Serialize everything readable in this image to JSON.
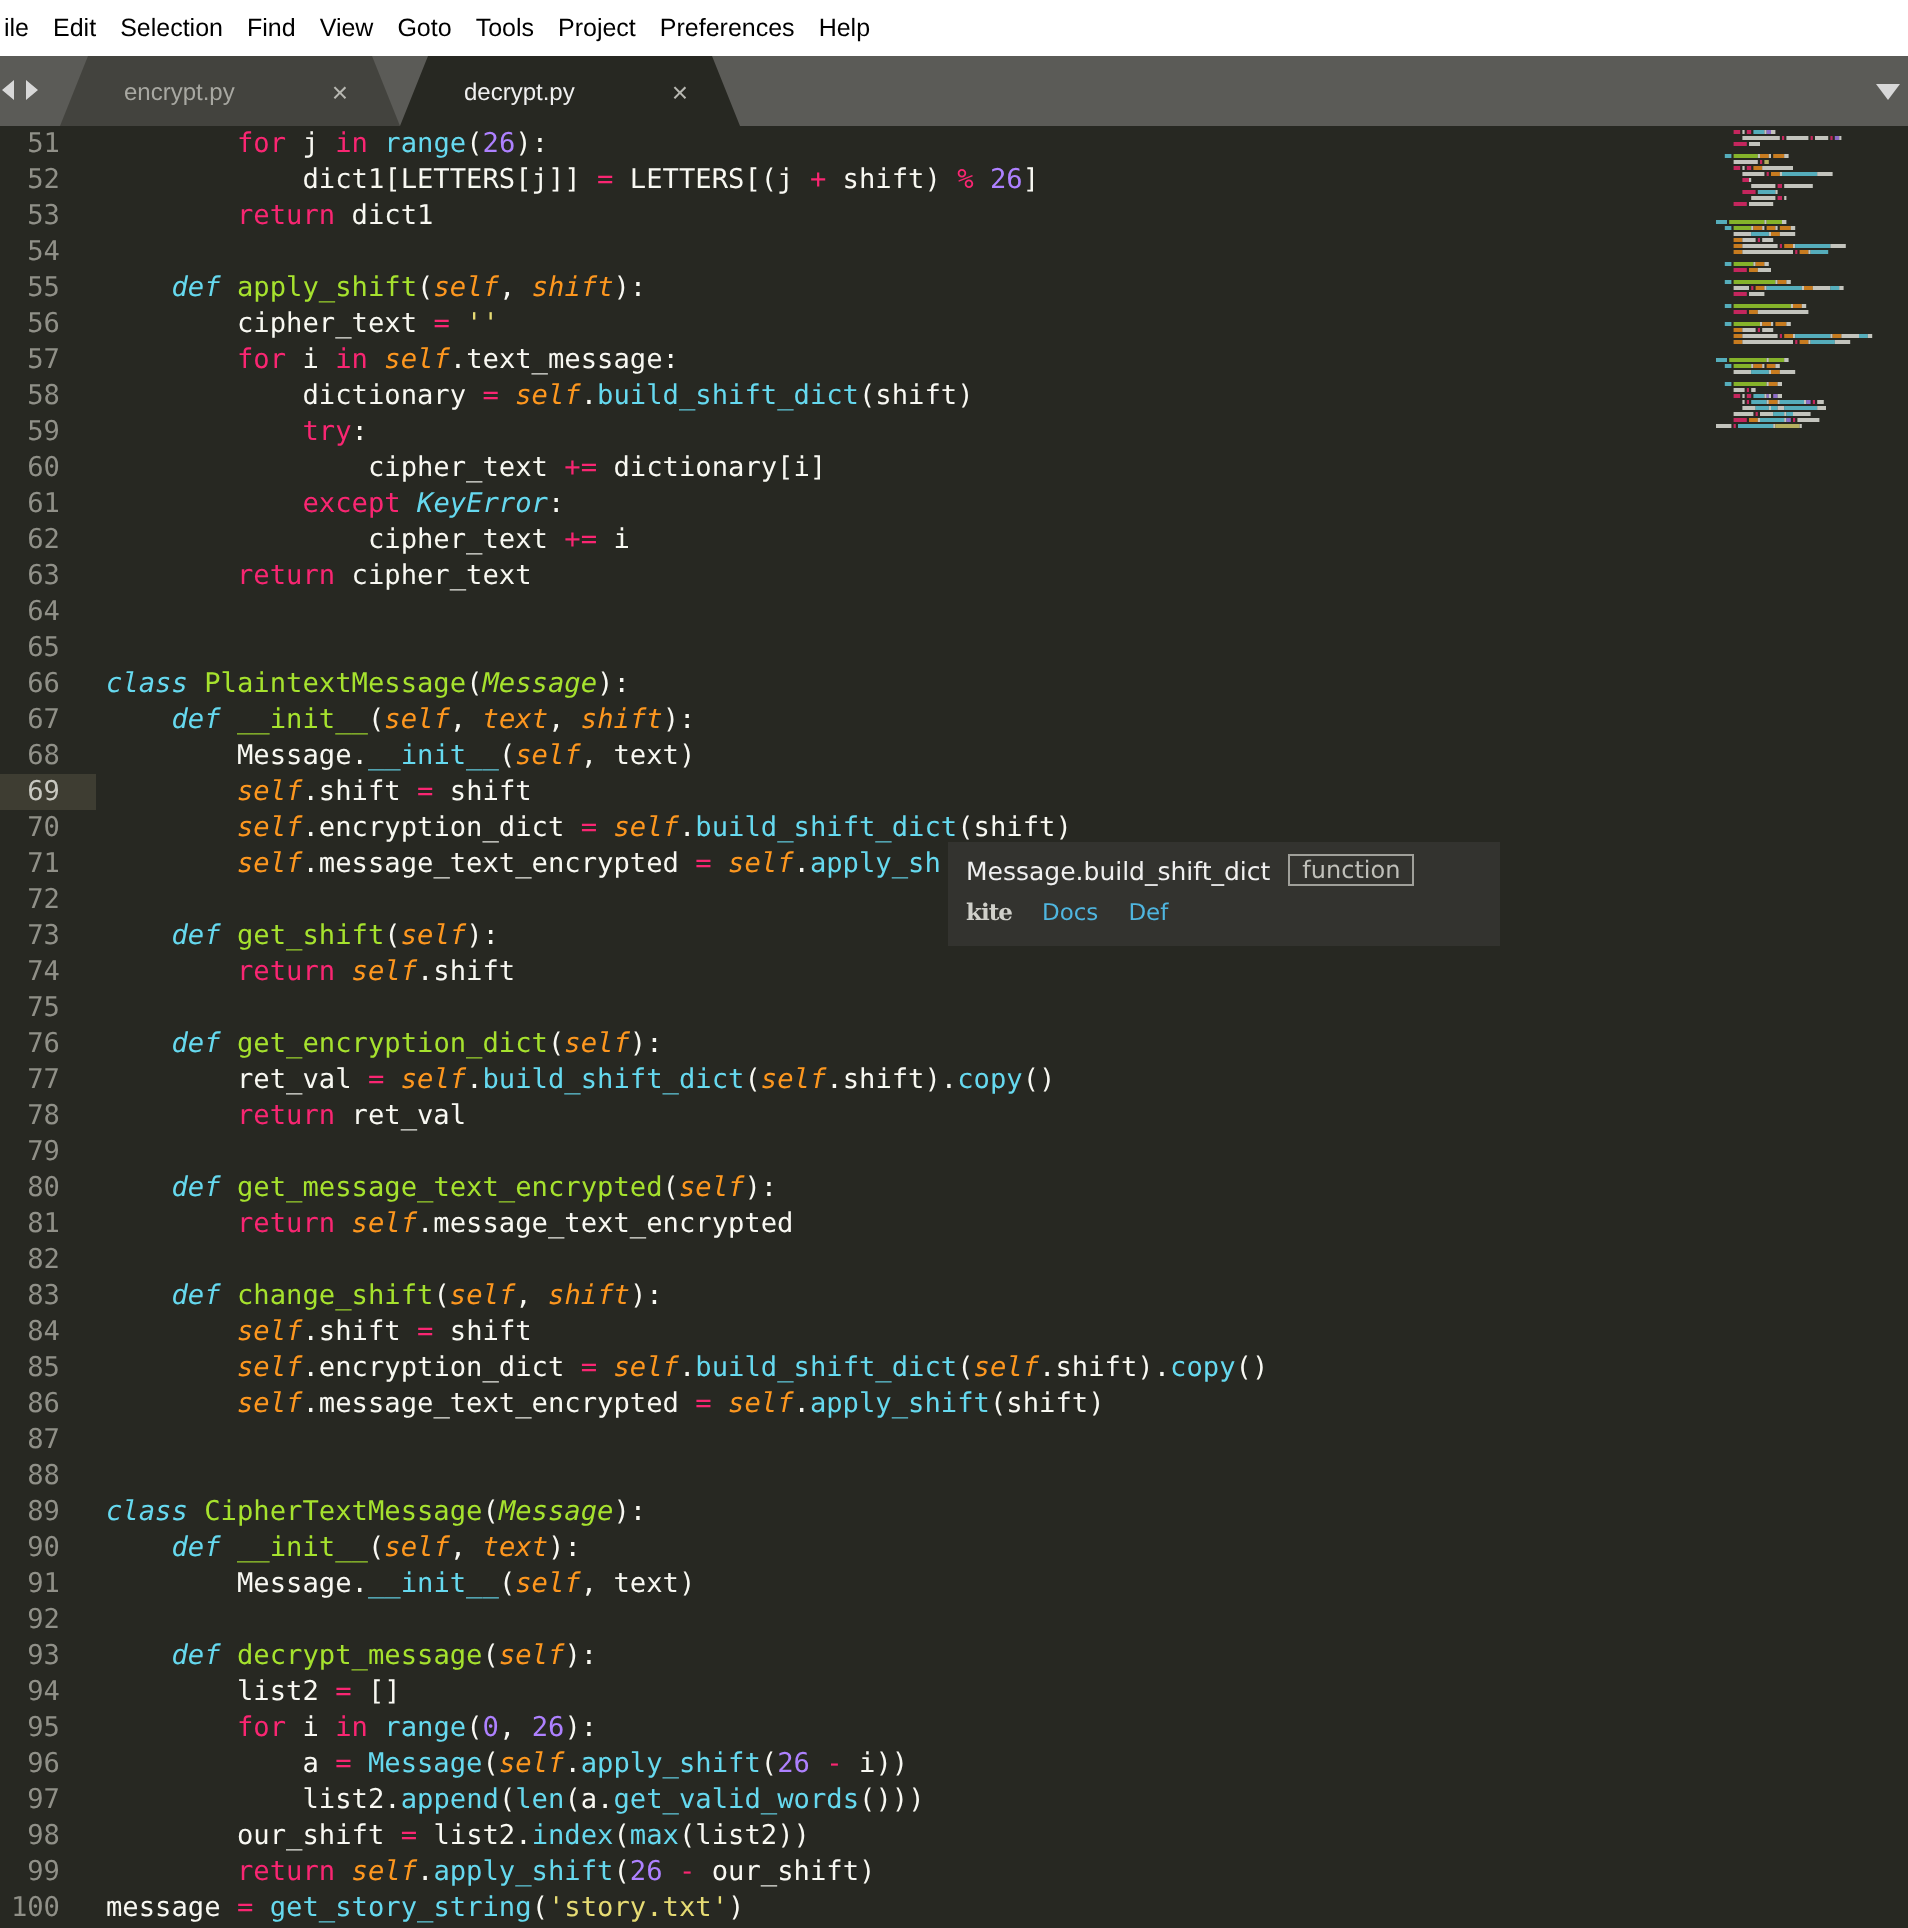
{
  "menu": [
    "ile",
    "Edit",
    "Selection",
    "Find",
    "View",
    "Goto",
    "Tools",
    "Project",
    "Preferences",
    "Help"
  ],
  "tabs": [
    {
      "label": "encrypt.py",
      "selected": false,
      "close": "×"
    },
    {
      "label": "decrypt.py",
      "selected": true,
      "close": "×"
    }
  ],
  "lines": [
    {
      "number": "51",
      "current": false,
      "tokens": [
        {
          "kind": "keyword",
          "text": "        for"
        },
        {
          "kind": "plain",
          "text": " j "
        },
        {
          "kind": "keyword",
          "text": "in"
        },
        {
          "kind": "call",
          "text": " range"
        },
        {
          "kind": "plain",
          "text": "("
        },
        {
          "kind": "number",
          "text": "26"
        },
        {
          "kind": "plain",
          "text": "):"
        }
      ]
    },
    {
      "number": "52",
      "current": false,
      "tokens": [
        {
          "kind": "plain",
          "text": "            dict1[LETTERS[j]] "
        },
        {
          "kind": "keyword",
          "text": "="
        },
        {
          "kind": "plain",
          "text": " LETTERS[(j "
        },
        {
          "kind": "keyword",
          "text": "+"
        },
        {
          "kind": "plain",
          "text": " shift) "
        },
        {
          "kind": "keyword",
          "text": "%"
        },
        {
          "kind": "number",
          "text": " 26"
        },
        {
          "kind": "plain",
          "text": "]"
        }
      ]
    },
    {
      "number": "53",
      "current": false,
      "tokens": [
        {
          "kind": "keyword",
          "text": "        return"
        },
        {
          "kind": "plain",
          "text": " dict1"
        }
      ]
    },
    {
      "number": "54",
      "current": false
    },
    {
      "number": "55",
      "current": false,
      "tokens": [
        {
          "kind": "storage",
          "text": "    def"
        },
        {
          "kind": "function",
          "text": " apply_shift"
        },
        {
          "kind": "plain",
          "text": "("
        },
        {
          "kind": "param",
          "text": "self"
        },
        {
          "kind": "plain",
          "text": ", "
        },
        {
          "kind": "param",
          "text": "shift"
        },
        {
          "kind": "plain",
          "text": "):"
        }
      ]
    },
    {
      "number": "56",
      "current": false,
      "tokens": [
        {
          "kind": "plain",
          "text": "        cipher_text "
        },
        {
          "kind": "keyword",
          "text": "="
        },
        {
          "kind": "string",
          "text": " ''"
        }
      ]
    },
    {
      "number": "57",
      "current": false,
      "tokens": [
        {
          "kind": "keyword",
          "text": "        for"
        },
        {
          "kind": "plain",
          "text": " i "
        },
        {
          "kind": "keyword",
          "text": "in"
        },
        {
          "kind": "param",
          "text": " self"
        },
        {
          "kind": "plain",
          "text": ".text_message:"
        }
      ]
    },
    {
      "number": "58",
      "current": false,
      "tokens": [
        {
          "kind": "plain",
          "text": "            dictionary "
        },
        {
          "kind": "keyword",
          "text": "="
        },
        {
          "kind": "param",
          "text": " self"
        },
        {
          "kind": "plain",
          "text": "."
        },
        {
          "kind": "call",
          "text": "build_shift_dict"
        },
        {
          "kind": "plain",
          "text": "(shift)"
        }
      ]
    },
    {
      "number": "59",
      "current": false,
      "tokens": [
        {
          "kind": "keyword",
          "text": "            try"
        },
        {
          "kind": "plain",
          "text": ":"
        }
      ]
    },
    {
      "number": "60",
      "current": false,
      "tokens": [
        {
          "kind": "plain",
          "text": "                cipher_text "
        },
        {
          "kind": "keyword",
          "text": "+="
        },
        {
          "kind": "plain",
          "text": " dictionary[i]"
        }
      ]
    },
    {
      "number": "61",
      "current": false,
      "tokens": [
        {
          "kind": "keyword",
          "text": "            except"
        },
        {
          "kind": "type",
          "text": " KeyError"
        },
        {
          "kind": "plain",
          "text": ":"
        }
      ]
    },
    {
      "number": "62",
      "current": false,
      "tokens": [
        {
          "kind": "plain",
          "text": "                cipher_text "
        },
        {
          "kind": "keyword",
          "text": "+="
        },
        {
          "kind": "plain",
          "text": " i"
        }
      ]
    },
    {
      "number": "63",
      "current": false,
      "tokens": [
        {
          "kind": "keyword",
          "text": "        return"
        },
        {
          "kind": "plain",
          "text": " cipher_text"
        }
      ]
    },
    {
      "number": "64",
      "current": false
    },
    {
      "number": "65",
      "current": false
    },
    {
      "number": "66",
      "current": false,
      "tokens": [
        {
          "kind": "storage",
          "text": "class"
        },
        {
          "kind": "function",
          "text": " PlaintextMessage"
        },
        {
          "kind": "plain",
          "text": "("
        },
        {
          "kind": "base",
          "text": "Message"
        },
        {
          "kind": "plain",
          "text": "):"
        }
      ]
    },
    {
      "number": "67",
      "current": false,
      "tokens": [
        {
          "kind": "storage",
          "text": "    def"
        },
        {
          "kind": "function",
          "text": " __init__"
        },
        {
          "kind": "plain",
          "text": "("
        },
        {
          "kind": "param",
          "text": "self"
        },
        {
          "kind": "plain",
          "text": ", "
        },
        {
          "kind": "param",
          "text": "text"
        },
        {
          "kind": "plain",
          "text": ", "
        },
        {
          "kind": "param",
          "text": "shift"
        },
        {
          "kind": "plain",
          "text": "):"
        }
      ]
    },
    {
      "number": "68",
      "current": false,
      "tokens": [
        {
          "kind": "plain",
          "text": "        Message."
        },
        {
          "kind": "call",
          "text": "__init__"
        },
        {
          "kind": "plain",
          "text": "("
        },
        {
          "kind": "param",
          "text": "self"
        },
        {
          "kind": "plain",
          "text": ", text)"
        }
      ]
    },
    {
      "number": "69",
      "current": true,
      "tokens": [
        {
          "kind": "param",
          "text": "        self"
        },
        {
          "kind": "plain",
          "text": ".shift "
        },
        {
          "kind": "keyword",
          "text": "="
        },
        {
          "kind": "plain",
          "text": " shift"
        }
      ]
    },
    {
      "number": "70",
      "current": false,
      "tokens": [
        {
          "kind": "param",
          "text": "        self"
        },
        {
          "kind": "plain",
          "text": ".encryption_dict "
        },
        {
          "kind": "keyword",
          "text": "="
        },
        {
          "kind": "param",
          "text": " self"
        },
        {
          "kind": "plain",
          "text": "."
        },
        {
          "kind": "call",
          "text": "build_shift_dict"
        },
        {
          "kind": "plain",
          "text": "(shift)"
        }
      ]
    },
    {
      "number": "71",
      "current": false,
      "tokens": [
        {
          "kind": "param",
          "text": "        self"
        },
        {
          "kind": "plain",
          "text": ".message_text_encrypted "
        },
        {
          "kind": "keyword",
          "text": "="
        },
        {
          "kind": "param",
          "text": " self"
        },
        {
          "kind": "plain",
          "text": "."
        },
        {
          "kind": "call",
          "text": "apply_sh"
        }
      ]
    },
    {
      "number": "72",
      "current": false
    },
    {
      "number": "73",
      "current": false,
      "tokens": [
        {
          "kind": "storage",
          "text": "    def"
        },
        {
          "kind": "function",
          "text": " get_shift"
        },
        {
          "kind": "plain",
          "text": "("
        },
        {
          "kind": "param",
          "text": "self"
        },
        {
          "kind": "plain",
          "text": "):"
        }
      ]
    },
    {
      "number": "74",
      "current": false,
      "tokens": [
        {
          "kind": "keyword",
          "text": "        return"
        },
        {
          "kind": "param",
          "text": " self"
        },
        {
          "kind": "plain",
          "text": ".shift"
        }
      ]
    },
    {
      "number": "75",
      "current": false
    },
    {
      "number": "76",
      "current": false,
      "tokens": [
        {
          "kind": "storage",
          "text": "    def"
        },
        {
          "kind": "function",
          "text": " get_encryption_dict"
        },
        {
          "kind": "plain",
          "text": "("
        },
        {
          "kind": "param",
          "text": "self"
        },
        {
          "kind": "plain",
          "text": "):"
        }
      ]
    },
    {
      "number": "77",
      "current": false,
      "tokens": [
        {
          "kind": "plain",
          "text": "        ret_val "
        },
        {
          "kind": "keyword",
          "text": "="
        },
        {
          "kind": "param",
          "text": " self"
        },
        {
          "kind": "plain",
          "text": "."
        },
        {
          "kind": "call",
          "text": "build_shift_dict"
        },
        {
          "kind": "plain",
          "text": "("
        },
        {
          "kind": "param",
          "text": "self"
        },
        {
          "kind": "plain",
          "text": ".shift)."
        },
        {
          "kind": "call",
          "text": "copy"
        },
        {
          "kind": "plain",
          "text": "()"
        }
      ]
    },
    {
      "number": "78",
      "current": false,
      "tokens": [
        {
          "kind": "keyword",
          "text": "        return"
        },
        {
          "kind": "plain",
          "text": " ret_val"
        }
      ]
    },
    {
      "number": "79",
      "current": false
    },
    {
      "number": "80",
      "current": false,
      "tokens": [
        {
          "kind": "storage",
          "text": "    def"
        },
        {
          "kind": "function",
          "text": " get_message_text_encrypted"
        },
        {
          "kind": "plain",
          "text": "("
        },
        {
          "kind": "param",
          "text": "self"
        },
        {
          "kind": "plain",
          "text": "):"
        }
      ]
    },
    {
      "number": "81",
      "current": false,
      "tokens": [
        {
          "kind": "keyword",
          "text": "        return"
        },
        {
          "kind": "param",
          "text": " self"
        },
        {
          "kind": "plain",
          "text": ".message_text_encrypted"
        }
      ]
    },
    {
      "number": "82",
      "current": false
    },
    {
      "number": "83",
      "current": false,
      "tokens": [
        {
          "kind": "storage",
          "text": "    def"
        },
        {
          "kind": "function",
          "text": " change_shift"
        },
        {
          "kind": "plain",
          "text": "("
        },
        {
          "kind": "param",
          "text": "self"
        },
        {
          "kind": "plain",
          "text": ", "
        },
        {
          "kind": "param",
          "text": "shift"
        },
        {
          "kind": "plain",
          "text": "):"
        }
      ]
    },
    {
      "number": "84",
      "current": false,
      "tokens": [
        {
          "kind": "param",
          "text": "        self"
        },
        {
          "kind": "plain",
          "text": ".shift "
        },
        {
          "kind": "keyword",
          "text": "="
        },
        {
          "kind": "plain",
          "text": " shift"
        }
      ]
    },
    {
      "number": "85",
      "current": false,
      "tokens": [
        {
          "kind": "param",
          "text": "        self"
        },
        {
          "kind": "plain",
          "text": ".encryption_dict "
        },
        {
          "kind": "keyword",
          "text": "="
        },
        {
          "kind": "param",
          "text": " self"
        },
        {
          "kind": "plain",
          "text": "."
        },
        {
          "kind": "call",
          "text": "build_shift_dict"
        },
        {
          "kind": "plain",
          "text": "("
        },
        {
          "kind": "param",
          "text": "self"
        },
        {
          "kind": "plain",
          "text": ".shift)."
        },
        {
          "kind": "call",
          "text": "copy"
        },
        {
          "kind": "plain",
          "text": "()"
        }
      ]
    },
    {
      "number": "86",
      "current": false,
      "tokens": [
        {
          "kind": "param",
          "text": "        self"
        },
        {
          "kind": "plain",
          "text": ".message_text_encrypted "
        },
        {
          "kind": "keyword",
          "text": "="
        },
        {
          "kind": "param",
          "text": " self"
        },
        {
          "kind": "plain",
          "text": "."
        },
        {
          "kind": "call",
          "text": "apply_shift"
        },
        {
          "kind": "plain",
          "text": "(shift)"
        }
      ]
    },
    {
      "number": "87",
      "current": false
    },
    {
      "number": "88",
      "current": false
    },
    {
      "number": "89",
      "current": false,
      "tokens": [
        {
          "kind": "storage",
          "text": "class"
        },
        {
          "kind": "function",
          "text": " CipherTextMessage"
        },
        {
          "kind": "plain",
          "text": "("
        },
        {
          "kind": "base",
          "text": "Message"
        },
        {
          "kind": "plain",
          "text": "):"
        }
      ]
    },
    {
      "number": "90",
      "current": false,
      "tokens": [
        {
          "kind": "storage",
          "text": "    def"
        },
        {
          "kind": "function",
          "text": " __init__"
        },
        {
          "kind": "plain",
          "text": "("
        },
        {
          "kind": "param",
          "text": "self"
        },
        {
          "kind": "plain",
          "text": ", "
        },
        {
          "kind": "param",
          "text": "text"
        },
        {
          "kind": "plain",
          "text": "):"
        }
      ]
    },
    {
      "number": "91",
      "current": false,
      "tokens": [
        {
          "kind": "plain",
          "text": "        Message."
        },
        {
          "kind": "call",
          "text": "__init__"
        },
        {
          "kind": "plain",
          "text": "("
        },
        {
          "kind": "param",
          "text": "self"
        },
        {
          "kind": "plain",
          "text": ", text)"
        }
      ]
    },
    {
      "number": "92",
      "current": false
    },
    {
      "number": "93",
      "current": false,
      "tokens": [
        {
          "kind": "storage",
          "text": "    def"
        },
        {
          "kind": "function",
          "text": " decrypt_message"
        },
        {
          "kind": "plain",
          "text": "("
        },
        {
          "kind": "param",
          "text": "self"
        },
        {
          "kind": "plain",
          "text": "):"
        }
      ]
    },
    {
      "number": "94",
      "current": false,
      "tokens": [
        {
          "kind": "plain",
          "text": "        list2 "
        },
        {
          "kind": "keyword",
          "text": "="
        },
        {
          "kind": "plain",
          "text": " []"
        }
      ]
    },
    {
      "number": "95",
      "current": false,
      "tokens": [
        {
          "kind": "keyword",
          "text": "        for"
        },
        {
          "kind": "plain",
          "text": " i "
        },
        {
          "kind": "keyword",
          "text": "in"
        },
        {
          "kind": "call",
          "text": " range"
        },
        {
          "kind": "plain",
          "text": "("
        },
        {
          "kind": "number",
          "text": "0"
        },
        {
          "kind": "plain",
          "text": ", "
        },
        {
          "kind": "number",
          "text": "26"
        },
        {
          "kind": "plain",
          "text": "):"
        }
      ]
    },
    {
      "number": "96",
      "current": false,
      "tokens": [
        {
          "kind": "plain",
          "text": "            a "
        },
        {
          "kind": "keyword",
          "text": "="
        },
        {
          "kind": "call",
          "text": " Message"
        },
        {
          "kind": "plain",
          "text": "("
        },
        {
          "kind": "param",
          "text": "self"
        },
        {
          "kind": "plain",
          "text": "."
        },
        {
          "kind": "call",
          "text": "apply_shift"
        },
        {
          "kind": "plain",
          "text": "("
        },
        {
          "kind": "number",
          "text": "26"
        },
        {
          "kind": "keyword",
          "text": " -"
        },
        {
          "kind": "plain",
          "text": " i))"
        }
      ]
    },
    {
      "number": "97",
      "current": false,
      "tokens": [
        {
          "kind": "plain",
          "text": "            list2."
        },
        {
          "kind": "call",
          "text": "append"
        },
        {
          "kind": "plain",
          "text": "("
        },
        {
          "kind": "call",
          "text": "len"
        },
        {
          "kind": "plain",
          "text": "(a."
        },
        {
          "kind": "call",
          "text": "get_valid_words"
        },
        {
          "kind": "plain",
          "text": "()))"
        }
      ]
    },
    {
      "number": "98",
      "current": false,
      "tokens": [
        {
          "kind": "plain",
          "text": "        our_shift "
        },
        {
          "kind": "keyword",
          "text": "="
        },
        {
          "kind": "plain",
          "text": " list2."
        },
        {
          "kind": "call",
          "text": "index"
        },
        {
          "kind": "plain",
          "text": "("
        },
        {
          "kind": "call",
          "text": "max"
        },
        {
          "kind": "plain",
          "text": "(list2))"
        }
      ]
    },
    {
      "number": "99",
      "current": false,
      "tokens": [
        {
          "kind": "keyword",
          "text": "        return"
        },
        {
          "kind": "param",
          "text": " self"
        },
        {
          "kind": "plain",
          "text": "."
        },
        {
          "kind": "call",
          "text": "apply_shift"
        },
        {
          "kind": "plain",
          "text": "("
        },
        {
          "kind": "number",
          "text": "26"
        },
        {
          "kind": "keyword",
          "text": " -"
        },
        {
          "kind": "plain",
          "text": " our_shift)"
        }
      ]
    },
    {
      "number": "100",
      "current": false,
      "tokens": [
        {
          "kind": "plain",
          "text": "message "
        },
        {
          "kind": "keyword",
          "text": "="
        },
        {
          "kind": "call",
          "text": " get_story_string"
        },
        {
          "kind": "plain",
          "text": "("
        },
        {
          "kind": "string",
          "text": "'story.txt'"
        },
        {
          "kind": "plain",
          "text": ")"
        }
      ]
    }
  ],
  "tooltip": {
    "signature": "Message.build_shift_dict",
    "type": "function",
    "brand": "kite",
    "links": [
      "Docs",
      "Def"
    ]
  }
}
